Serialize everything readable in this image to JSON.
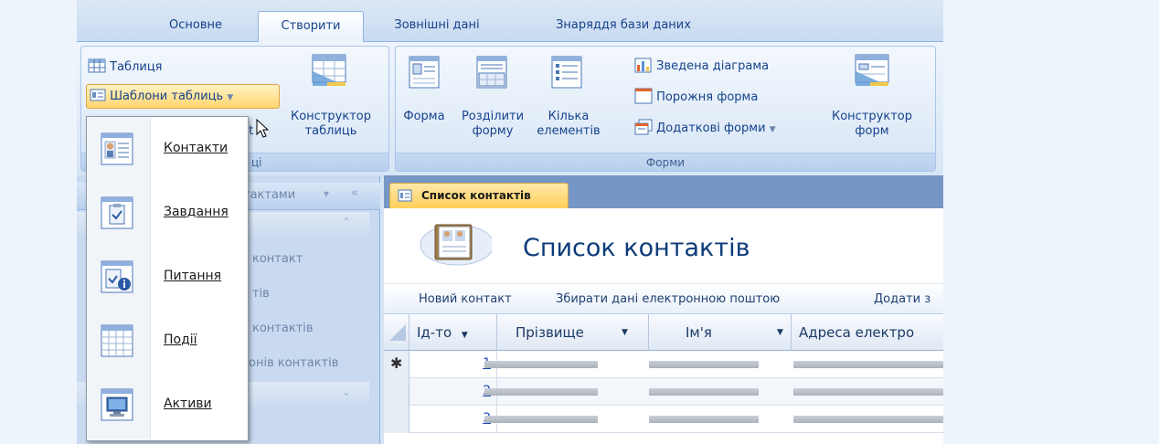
{
  "tabs": [
    "Основне",
    "Створити",
    "Зовнішні дані",
    "Знаряддя бази даних"
  ],
  "ribbon": {
    "table": "Таблиця",
    "table_templates": "Шаблони таблиць",
    "partial_label_nt": "nt",
    "table_designer_line1": "Конструктор",
    "table_designer_line2": "таблиць",
    "tables_group_partial": "ці",
    "form": "Форма",
    "split_form_line1": "Розділити",
    "split_form_line2": "форму",
    "multiple_items_line1": "Кілька",
    "multiple_items_line2": "елементів",
    "pivot_chart": "Зведена діаграма",
    "blank_form": "Порожня форма",
    "more_forms": "Додаткові форми",
    "form_designer_line1": "Конструктор",
    "form_designer_line2": "форм",
    "forms_group": "Форми"
  },
  "menu": {
    "items": [
      "Контакти",
      "Завдання",
      "Питання",
      "Події",
      "Активи"
    ]
  },
  "nav": {
    "header_partial": "тактами",
    "items": [
      "контакт",
      "тів",
      "контактів",
      "онів контактів"
    ]
  },
  "doc": {
    "tab": "Список контактів",
    "title": "Список контактів",
    "actions": [
      "Новий контакт",
      "Збирати дані електронною поштою",
      "Додати з"
    ],
    "columns": [
      "Ід-то",
      "Прізвище",
      "Ім'я",
      "Адреса електро"
    ],
    "new_row_marker": "✱",
    "row_ids": [
      "1",
      "2",
      "3"
    ]
  }
}
